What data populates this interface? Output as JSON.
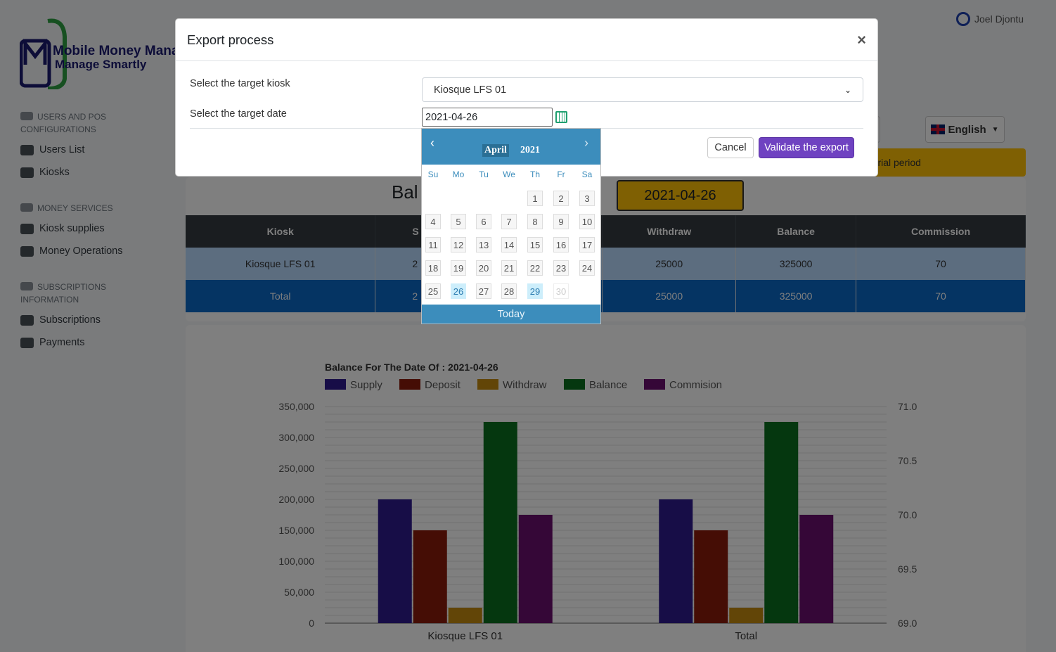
{
  "app": {
    "logo_line1": "Mobile Money Mana",
    "logo_line2": "Manage Smartly",
    "user_name": "Joel Djontu",
    "language": "English",
    "trial_text": "r trial period"
  },
  "sidebar": {
    "sections": [
      {
        "title": "USERS AND POS CONFIGURATIONS",
        "items": [
          "Users List",
          "Kiosks"
        ]
      },
      {
        "title": "MONEY SERVICES",
        "items": [
          "Kiosk supplies",
          "Money Operations"
        ]
      },
      {
        "title": "SUBSCRIPTIONS INFORMATION",
        "items": [
          "Subscriptions",
          "Payments"
        ]
      }
    ]
  },
  "main": {
    "title_partial": "Bal",
    "date_badge": "2021-04-26",
    "table": {
      "headers": [
        "Kiosk",
        "S",
        "Withdraw",
        "Balance",
        "Commission"
      ],
      "rows": [
        [
          "Kiosque LFS 01",
          "2",
          "25000",
          "325000",
          "70"
        ],
        [
          "Total",
          "2",
          "25000",
          "325000",
          "70"
        ]
      ]
    }
  },
  "modal": {
    "title": "Export process",
    "close": "×",
    "kiosk_label": "Select the target kiosk",
    "kiosk_value": "Kiosque LFS 01",
    "date_label": "Select the target date",
    "date_value": "2021-04-26",
    "cancel": "Cancel",
    "validate": "Validate the export"
  },
  "datepicker": {
    "prev": "‹",
    "next": "›",
    "month": "April",
    "year": "2021",
    "weekdays": [
      "Su",
      "Mo",
      "Tu",
      "We",
      "Th",
      "Fr",
      "Sa"
    ],
    "first_weekday_index": 4,
    "days_in_month": 30,
    "selected": [
      26,
      29
    ],
    "disabled": [
      30
    ],
    "today": "Today"
  },
  "chart_data": {
    "type": "bar",
    "title": "Balance For The Date Of : 2021-04-26",
    "categories": [
      "Kiosque LFS 01",
      "Total"
    ],
    "series": [
      {
        "name": "Supply",
        "color": "#2e1a8f",
        "values": [
          200000,
          200000
        ]
      },
      {
        "name": "Deposit",
        "color": "#8b1a0a",
        "values": [
          150000,
          150000
        ]
      },
      {
        "name": "Withdraw",
        "color": "#c58a0f",
        "values": [
          25000,
          25000
        ]
      },
      {
        "name": "Balance",
        "color": "#0a6e1f",
        "values": [
          325000,
          325000
        ]
      },
      {
        "name": "Commision",
        "color": "#6b0f6e",
        "values": [
          175000,
          175000
        ]
      }
    ],
    "ylim": [
      0,
      350000
    ],
    "yticks": [
      "0",
      "50,000",
      "100,000",
      "150,000",
      "200,000",
      "250,000",
      "300,000",
      "350,000"
    ],
    "y2lim": [
      69.0,
      71.0
    ],
    "y2ticks": [
      "69.0",
      "69.5",
      "70.0",
      "70.5",
      "71.0"
    ],
    "grid": true,
    "legend": "top-left"
  }
}
